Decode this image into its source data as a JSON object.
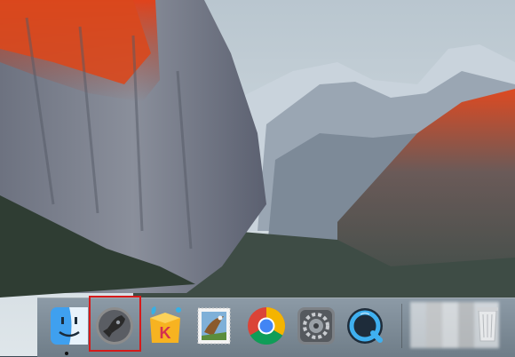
{
  "dock": {
    "items": [
      {
        "name": "finder-icon"
      },
      {
        "name": "launchpad-icon"
      },
      {
        "name": "kuwo-music-icon"
      },
      {
        "name": "mail-stamp-icon"
      },
      {
        "name": "chrome-icon"
      },
      {
        "name": "system-preferences-icon"
      },
      {
        "name": "quicktime-icon"
      }
    ],
    "highlighted_item": "launchpad-icon",
    "highlight_color": "#d61a1a"
  }
}
